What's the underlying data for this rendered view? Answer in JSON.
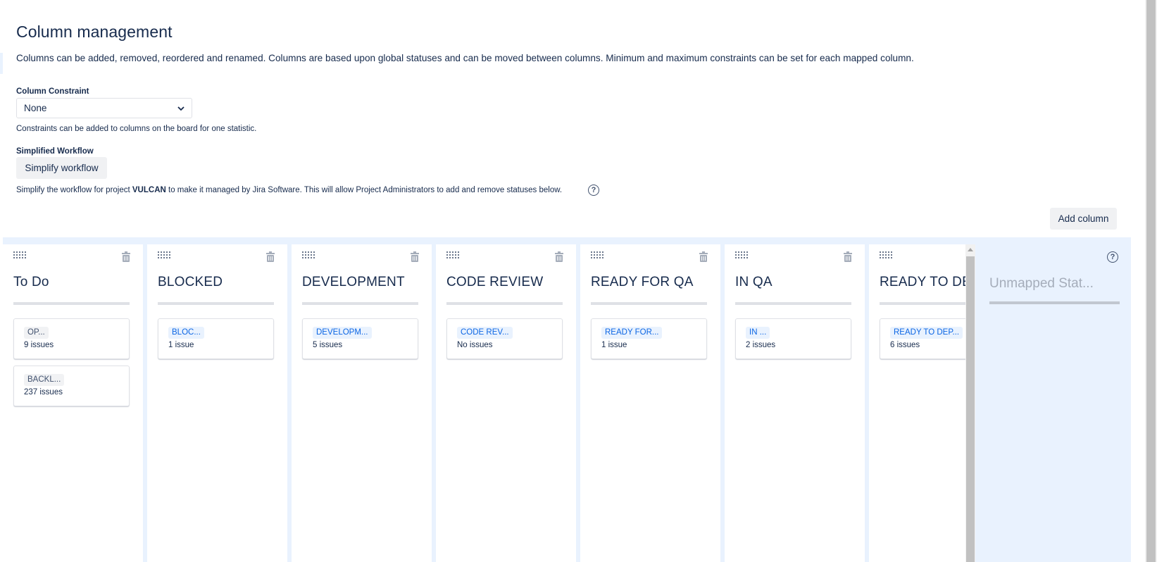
{
  "page": {
    "title": "Column management",
    "description": "Columns can be added, removed, reordered and renamed. Columns are based upon global statuses and can be moved between columns. Minimum and maximum constraints can be set for each mapped column."
  },
  "constraint": {
    "label": "Column Constraint",
    "selected": "None",
    "help": "Constraints can be added to columns on the board for one statistic."
  },
  "workflow": {
    "label": "Simplified Workflow",
    "button": "Simplify workflow",
    "help_prefix": "Simplify the workflow for project ",
    "project": "VULCAN",
    "help_suffix": " to make it managed by Jira Software. This will allow Project Administrators to add and remove statuses below.",
    "help_icon": "question-circle-icon"
  },
  "toolbar": {
    "add_column": "Add column"
  },
  "columns": [
    {
      "title": "To Do",
      "statuses": [
        {
          "name": "OP...",
          "count": "9 issues",
          "category": "grey"
        },
        {
          "name": "BACKL...",
          "count": "237 issues",
          "category": "grey"
        }
      ]
    },
    {
      "title": "BLOCKED",
      "statuses": [
        {
          "name": "BLOC...",
          "count": "1 issue",
          "category": "blue"
        }
      ]
    },
    {
      "title": "DEVELOPMENT",
      "statuses": [
        {
          "name": "DEVELOPM...",
          "count": "5 issues",
          "category": "blue"
        }
      ]
    },
    {
      "title": "CODE REVIEW",
      "statuses": [
        {
          "name": "CODE REV...",
          "count": "No issues",
          "category": "blue"
        }
      ]
    },
    {
      "title": "READY FOR QA",
      "statuses": [
        {
          "name": "READY FOR...",
          "count": "1 issue",
          "category": "blue"
        }
      ]
    },
    {
      "title": "IN QA",
      "statuses": [
        {
          "name": "IN ...",
          "count": "2 issues",
          "category": "blue"
        }
      ]
    },
    {
      "title": "READY TO DE",
      "statuses": [
        {
          "name": "READY TO DEP...",
          "count": "6 issues",
          "category": "blue"
        }
      ]
    }
  ],
  "unmapped": {
    "title": "Unmapped Stat...",
    "help_icon": "question-circle-icon"
  },
  "colors": {
    "board_bg": "#e9f2fe",
    "lozenge_blue_text": "#0c66e4",
    "lozenge_blue_bg": "#e9f2fe",
    "lozenge_grey_bg": "#f1f2f4",
    "text": "#172b4d"
  }
}
